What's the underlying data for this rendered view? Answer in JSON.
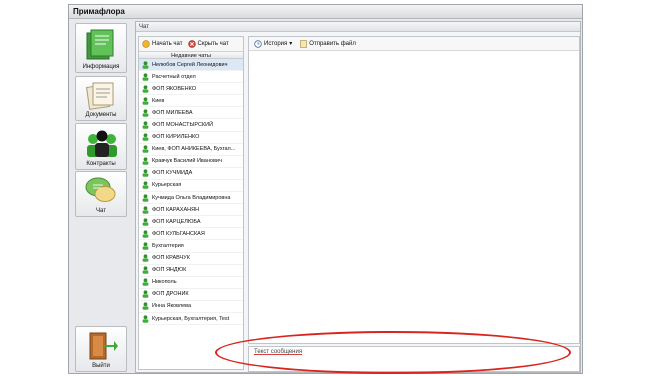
{
  "app": {
    "title": "Примафлора"
  },
  "nav": {
    "info": "Информация",
    "docs": "Документы",
    "contacts": "Контракты",
    "chat": "Чат",
    "exit": "Выйти"
  },
  "panel": {
    "title": "Чат"
  },
  "toolbar": {
    "start_chat": "Начать чат",
    "hide_chat": "Скрыть чат"
  },
  "chats": {
    "header": "Недавние чаты",
    "items": [
      "Нелюбов Сергей Леонидович",
      "Расчетный отдел",
      "ФОП ЯКОВЕНКО",
      "Киев",
      "ФОП МИЛЕЕВА",
      "ФОП МОНАСТЫРСКИЙ",
      "ФОП КИРИЛЕНКО",
      "Киев, ФОП АНИКЕЕВА, Бухгал...",
      "Кравчук Василий Иванович",
      "ФОП КУЧМИДА",
      "Курьерская",
      "Кучмида Ольга Владимировна",
      "ФОП КАРАХАНЯН",
      "ФОП КАРЦЕЛЮБА",
      "ФОП КУЛЬГАНСКАЯ",
      "Бухгалтерия",
      "ФОП КРАВЧУК",
      "ФОП ЯНДЮК",
      "Никополь",
      "ФОП ДРОНИК",
      "Инна Яковлева",
      "Курьерская, Бухгалтерия, Test"
    ]
  },
  "chat_toolbar": {
    "history": "История",
    "send_file": "Отправить файл"
  },
  "message": {
    "placeholder": "Текст сообщения"
  }
}
